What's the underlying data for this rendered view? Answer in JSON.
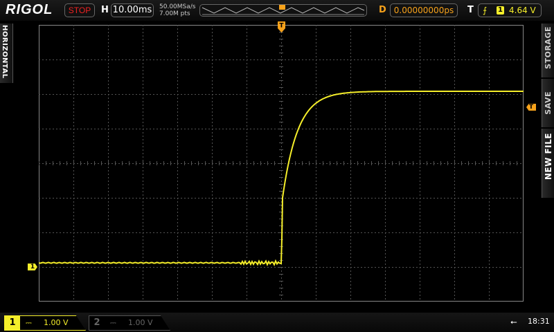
{
  "header": {
    "brand": "RIGOL",
    "run_state": "STOP",
    "horizontal_label": "H",
    "timebase": "10.00ms",
    "sample_rate": "50.00MSa/s",
    "memory_depth": "7.00M pts",
    "delay_label": "D",
    "delay_value": "0.00000000ps",
    "trigger_label": "T",
    "trigger_source": "1",
    "trigger_level": "4.64 V"
  },
  "left_menu": {
    "label": "HORIZONTAL"
  },
  "right_menu": {
    "items": [
      "STORAGE",
      "SAVE",
      "NEW FILE"
    ]
  },
  "markers": {
    "ch1_ground": "1",
    "trigger_position": "T",
    "trigger_level": "T"
  },
  "footer": {
    "channels": [
      {
        "number": "1",
        "coupling": "⎓",
        "scale": "1.00 V",
        "active": true
      },
      {
        "number": "2",
        "coupling": "⎓",
        "scale": "1.00 V",
        "active": false
      }
    ],
    "usb_icon": "usb-icon",
    "clock": "18:31"
  },
  "colors": {
    "ch1": "#f5ee2a",
    "trigger": "#f7a21b",
    "stop": "#e22222",
    "grid": "#555555"
  }
}
